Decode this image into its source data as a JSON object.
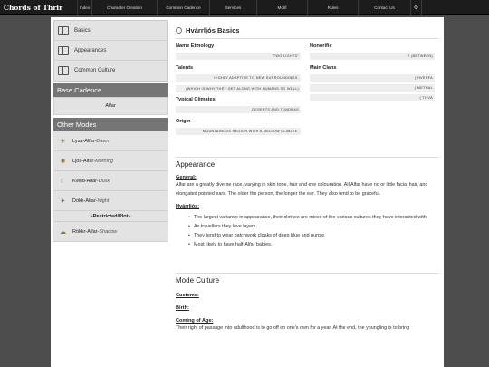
{
  "nav": {
    "brand": "Chords of Thrir",
    "items": [
      "Index",
      "Character Creation",
      "Common Cadence",
      "Services",
      "Motif",
      "Rules",
      "Contact Us"
    ]
  },
  "sidebar": {
    "links": [
      "Basics",
      "Appearances",
      "Common Culture"
    ],
    "base_cadence_title": "Base Cadence",
    "base_cadence_value": "Alfar",
    "other_modes_title": "Other Modes",
    "modes": [
      {
        "name": "Lysa-Alfar",
        "sep": " - ",
        "sub": "Dawn"
      },
      {
        "name": "Ljós-Alfar",
        "sep": " - ",
        "sub": "Morning"
      },
      {
        "name": "Kveld-Alfar",
        "sep": " - ",
        "sub": "Dusk"
      },
      {
        "name": "Dökk-Alfar",
        "sep": " - ",
        "sub": "Night"
      }
    ],
    "restricted": "~Restricted/Plot~",
    "rokkr": {
      "name": "Rökkr-Alfar",
      "sep": " - ",
      "sub": "Shadow"
    }
  },
  "main": {
    "title": "Hvárrljós Basics",
    "name_etym_label": "Name Etmology",
    "name_etym_value": "\"two lights\"",
    "honorific_label": "Honorific",
    "honorific_value": "í (between)",
    "talents_label": "Talents",
    "talents_1": "highly adaptive to new surroundings.",
    "talents_2": "(which is why they get along with humans so well)",
    "main_clans_label": "Main Clans",
    "clans": [
      "(`hverfa",
      "(`methal",
      "(`thvä"
    ],
    "climates_label": "Typical Climates",
    "climates_value": "deserts and tundras",
    "origin_label": "Origin",
    "origin_value": "mountainous region with a mellow climate.",
    "appearance_title": "Appearance",
    "general_label": "General:",
    "general_text": "Alfar are a greatly diverse race, varying in skin tone, hair and eye colouration. All Alfar have no or little facial hair, and elongated pointed ears. The older the person, the longer the ear. They also tend to be graceful.",
    "hv_label": "Hvárrljós:",
    "bullets": [
      "The largest variance in appearance, their clothes are mixes of the various cultures they have interacted with.",
      "As travellers they love layers.",
      "They tend to wear patchwork cloaks of deep blue and purple.",
      "Most likely to have half-Alfar babies."
    ],
    "mode_culture_title": "Mode Culture",
    "customs_label": "Customs:",
    "birth_label": "Birth:",
    "coming_label": "Coming of Age:",
    "coming_text": "Their right of passage into adulthood is to go off on one's own for a year. At the end, the youngling is to bring"
  }
}
